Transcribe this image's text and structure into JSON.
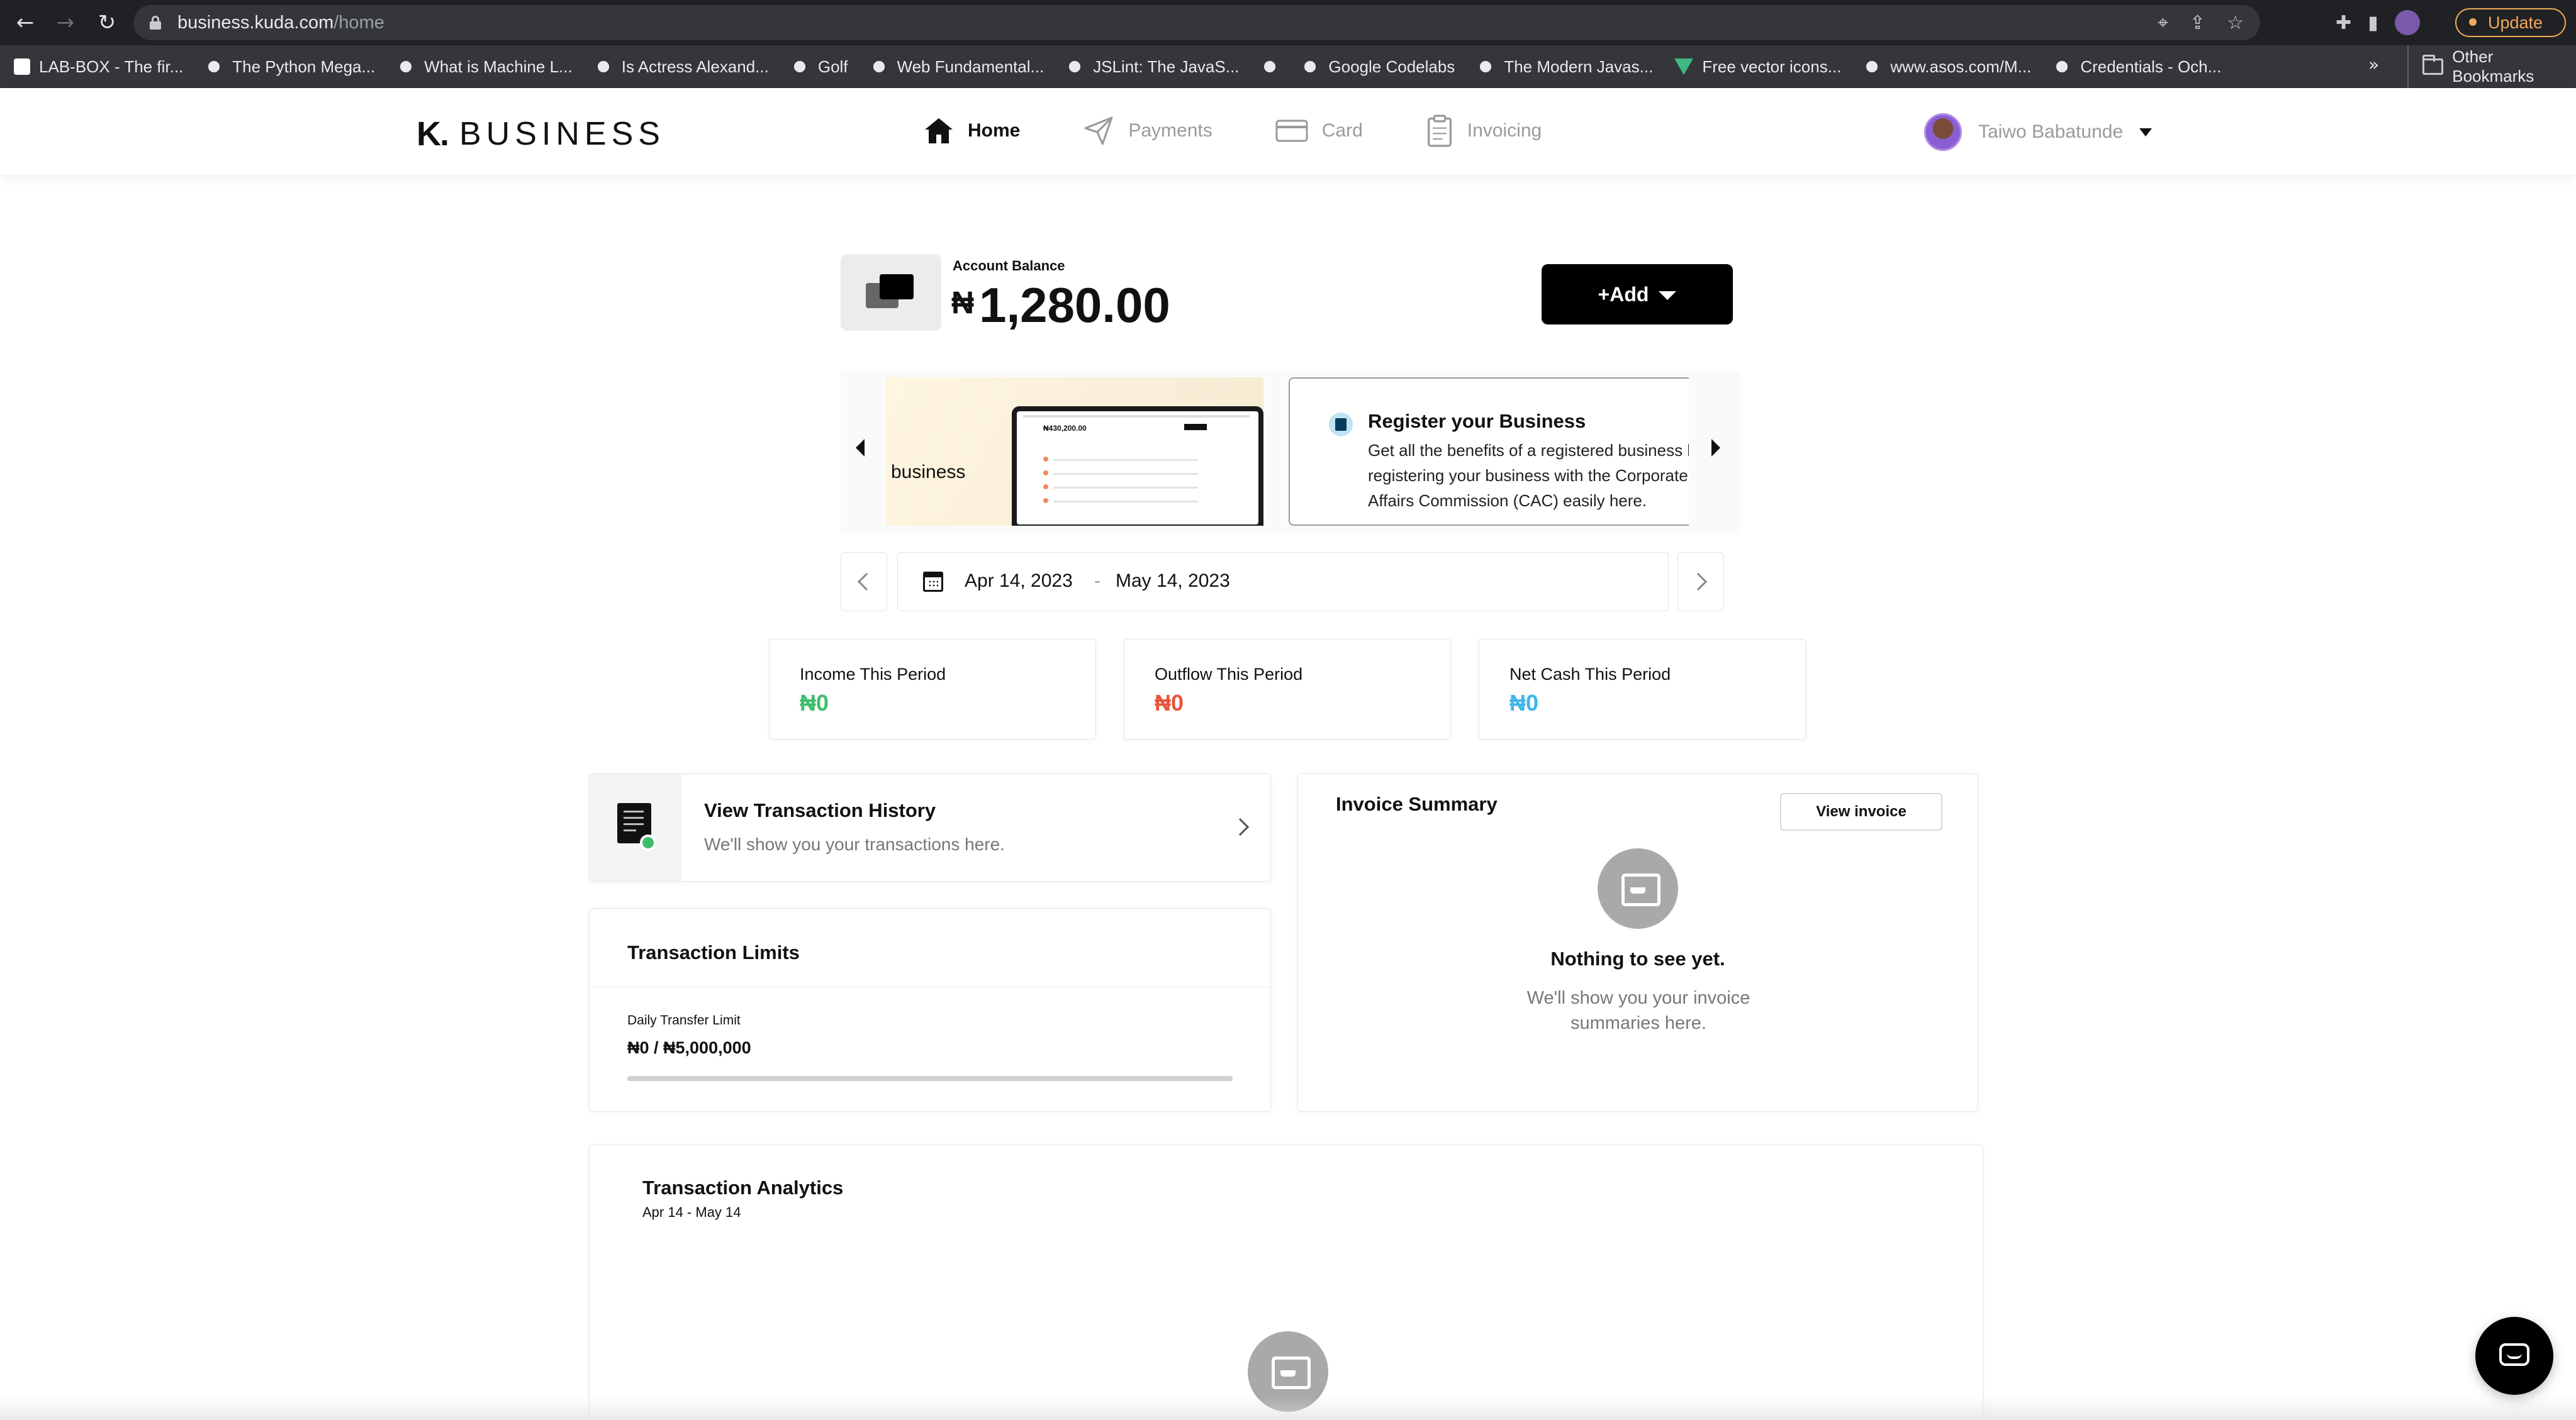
{
  "browser": {
    "url_host": "business.kuda.com",
    "url_path": "/home",
    "update_label": "Update",
    "bookmarks": [
      "LAB-BOX - The fir...",
      "The Python Mega...",
      "What is Machine L...",
      "Is Actress Alexand...",
      "Golf",
      "Web Fundamental...",
      "JSLint: The JavaS...",
      "",
      "Google Codelabs",
      "The Modern Javas...",
      "Free vector icons...",
      "www.asos.com/M...",
      "Credentials - Och..."
    ],
    "more_label": "»",
    "other_bookmarks": "Other Bookmarks"
  },
  "header": {
    "logo_mark": "K.",
    "logo_text": "BUSINESS",
    "nav": [
      {
        "label": "Home",
        "icon": "home-icon",
        "active": true
      },
      {
        "label": "Payments",
        "icon": "send-icon",
        "active": false
      },
      {
        "label": "Card",
        "icon": "card-icon",
        "active": false
      },
      {
        "label": "Invoicing",
        "icon": "clipboard-icon",
        "active": false
      }
    ],
    "user_name": "Taiwo Babatunde"
  },
  "balance": {
    "label": "Account Balance",
    "currency": "₦",
    "amount": "1,280.00",
    "add_label": "+Add"
  },
  "carousel": {
    "promo_text": "business",
    "promo_screen_balance": "₦430,200.00",
    "register_title": "Register your Business",
    "register_desc": "Get all the benefits of a registered business by registering your business with the Corporate Affairs Commission (CAC) easily here."
  },
  "date_range": {
    "from": "Apr 14, 2023",
    "separator": "-",
    "to": "May 14, 2023"
  },
  "stats": [
    {
      "label": "Income This Period",
      "value": "₦0",
      "color": "#3dbd6b"
    },
    {
      "label": "Outflow This Period",
      "value": "₦0",
      "color": "#e8553a"
    },
    {
      "label": "Net Cash This Period",
      "value": "₦0",
      "color": "#3fb6e8"
    }
  ],
  "history": {
    "title": "View Transaction History",
    "subtitle": "We'll show you your transactions here."
  },
  "limits": {
    "title": "Transaction Limits",
    "daily_label": "Daily Transfer Limit",
    "daily_value": "₦0 / ₦5,000,000",
    "used_fraction": 0
  },
  "invoice": {
    "title": "Invoice Summary",
    "view_label": "View invoice",
    "empty_title": "Nothing to see yet.",
    "empty_sub": "We'll show you your invoice summaries here."
  },
  "analytics": {
    "title": "Transaction Analytics",
    "range": "Apr 14 - May 14"
  }
}
